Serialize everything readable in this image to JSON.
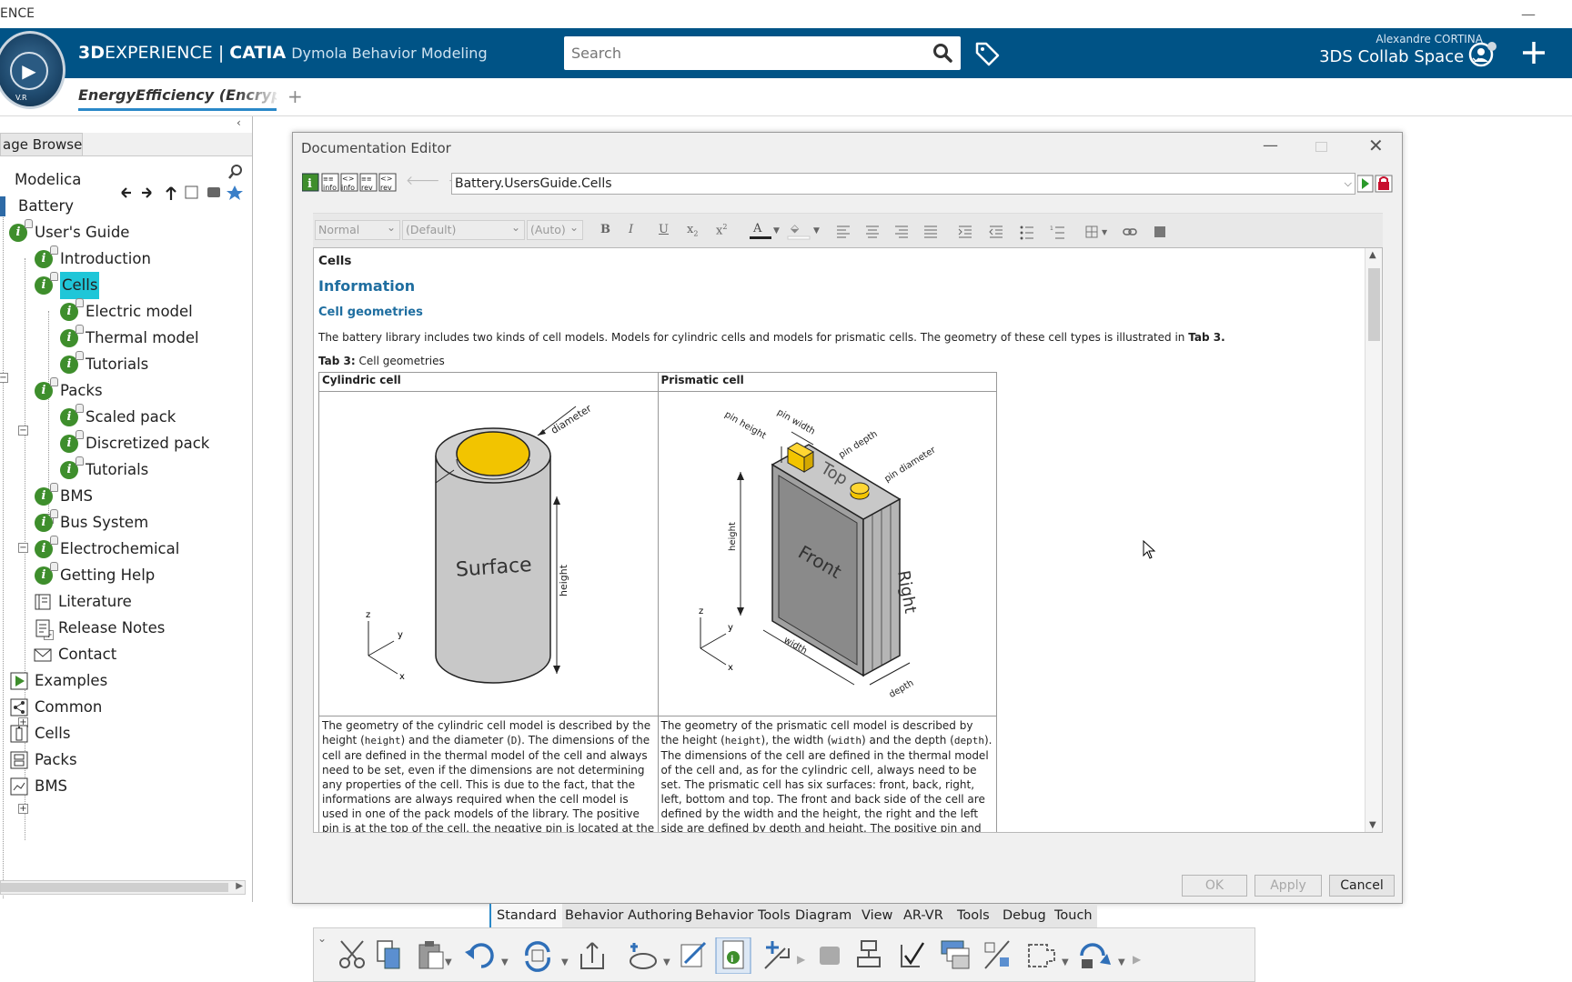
{
  "window": {
    "title": "ENCE",
    "minimize": "—"
  },
  "header": {
    "brand_bold": "3D",
    "brand_rest": "EXPERIENCE | ",
    "brand_catia": "CATIA",
    "app_name": "Dymola Behavior Modeling",
    "search_placeholder": "Search",
    "user_name": "Alexandre CORTINA",
    "collab_space": "3DS Collab Space ⌄",
    "compass_vr": "V.R"
  },
  "tabs": {
    "active": "EnergyEfficiency (Encrypted",
    "add": "+"
  },
  "package_browser": {
    "tab_label": "Package Browser",
    "tab_visible": "age Browser",
    "collapse": "‹",
    "items": [
      {
        "label": "Modelica"
      },
      {
        "label": "Battery"
      },
      {
        "label": "User's Guide"
      },
      {
        "label": "Introduction"
      },
      {
        "label": "Cells"
      },
      {
        "label": "Electric model"
      },
      {
        "label": "Thermal model"
      },
      {
        "label": "Tutorials"
      },
      {
        "label": "Packs"
      },
      {
        "label": "Scaled pack"
      },
      {
        "label": "Discretized pack"
      },
      {
        "label": "Tutorials"
      },
      {
        "label": "BMS"
      },
      {
        "label": "Bus System"
      },
      {
        "label": "Electrochemical"
      },
      {
        "label": "Getting Help"
      },
      {
        "label": "Literature"
      },
      {
        "label": "Release Notes"
      },
      {
        "label": "Contact"
      },
      {
        "label": "Examples"
      },
      {
        "label": "Common"
      },
      {
        "label": "Cells"
      },
      {
        "label": "Packs"
      },
      {
        "label": "BMS"
      }
    ]
  },
  "doc_editor": {
    "title": "Documentation Editor",
    "path": "Battery.UsersGuide.Cells",
    "format": {
      "style": "Normal",
      "font": "(Default)",
      "size": "(Auto)"
    },
    "content": {
      "heading": "Cells",
      "section": "Information",
      "subsection": "Cell geometries",
      "intro": "The battery library includes two kinds of cell models. Models for cylindric cells and models for prismatic cells. The geometry of these cell types is illustrated in ",
      "intro_ref": "Tab 3.",
      "caption_label": "Tab 3:",
      "caption_text": " Cell geometries",
      "col1": "Cylindric cell",
      "col2": "Prismatic cell",
      "fig_labels": {
        "diameter": "diameter",
        "surface": "Surface",
        "height": "height",
        "pin_width": "pin width",
        "pin_height": "pin height",
        "pin_depth": "pin depth",
        "pin_diameter": "pin diameter",
        "top": "Top",
        "front": "Front",
        "right": "Right",
        "width": "width",
        "depth": "depth",
        "z": "z",
        "y": "y",
        "x": "x"
      },
      "cyl_text_a": "The geometry of the cylindric cell model is described by the height (",
      "cyl_code_h": "height",
      "cyl_text_b": ") and the diameter (",
      "cyl_code_d": "D",
      "cyl_text_c": "). The dimensions of the cell are defined in the thermal model of the cell and always need to be set, even if the dimensions are not determining any properties of the cell. This is due to the fact, that the informations are always required when the cell model is used in one of the pack models of the library. The positive pin is at the top of the cell, the negative pin is located at the bottom. The",
      "pri_text_a": "The geometry of the prismatic cell model is described by the height (",
      "pri_code_h": "height",
      "pri_text_b": "), the width (",
      "pri_code_w": "width",
      "pri_text_c": ") and the depth (",
      "pri_code_d": "depth",
      "pri_text_d": "). The dimensions of the cell are defined in the thermal model of the cell and, as for the cylindric cell, always need to be set. The prismatic cell has six surfaces: front, back, right, left, bottom and top. The front and back side of the cell are defined by the width and the height, the right and the left side are defined by depth and height. The positive pin and the negative"
    },
    "buttons": {
      "ok": "OK",
      "apply": "Apply",
      "cancel": "Cancel"
    }
  },
  "ribbon": {
    "tabs": [
      "Standard",
      "Behavior Authoring",
      "Behavior Tools",
      "Diagram",
      "View",
      "AR-VR",
      "Tools",
      "Debug",
      "Touch"
    ]
  },
  "colors": {
    "topbar": "#005386",
    "accent": "#2a88c8",
    "selection": "#1fc6d8",
    "info_icon": "#3e8e2c"
  }
}
